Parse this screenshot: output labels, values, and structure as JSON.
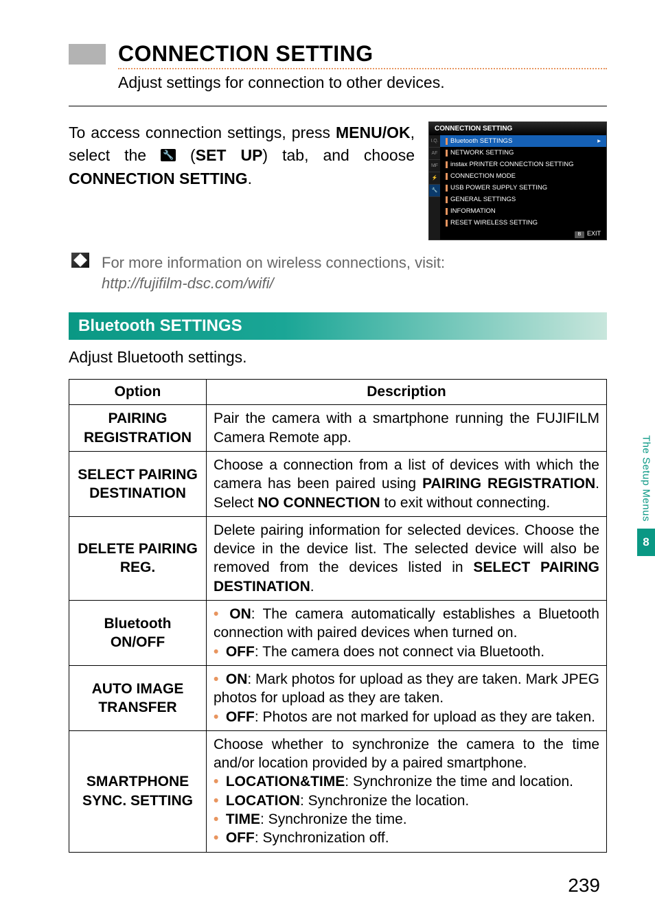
{
  "title": "CONNECTION SETTING",
  "subtitle": "Adjust settings for connection to other devices.",
  "intro_parts": {
    "p1": "To access connection settings, press ",
    "menuok": "MENU/OK",
    "p2": ", select the ",
    "setup": "SET UP",
    "p3": " tab, and choose ",
    "conn": "CONNECTION SETTING",
    "p4": "."
  },
  "menu": {
    "header": "CONNECTION SETTING",
    "items": [
      "Bluetooth SETTINGS",
      "NETWORK SETTING",
      "instax PRINTER CONNECTION SETTING",
      "CONNECTION MODE",
      "USB POWER SUPPLY SETTING",
      "GENERAL SETTINGS",
      "INFORMATION",
      "RESET WIRELESS SETTING"
    ],
    "exit": "EXIT",
    "tabs": [
      "I.Q.",
      "AF MF",
      "",
      "",
      ""
    ]
  },
  "note": {
    "line1": "For more information on wireless connections, visit:",
    "url": "http://fujifilm-dsc.com/wifi/"
  },
  "section": {
    "heading": "Bluetooth SETTINGS",
    "desc": "Adjust Bluetooth settings."
  },
  "table": {
    "head_option": "Option",
    "head_desc": "Description",
    "rows": [
      {
        "option": "PAIRING REGISTRATION",
        "desc_html": "Pair the camera with a smartphone running the FUJIFILM Camera Remote app."
      },
      {
        "option": "SELECT PAIRING DESTINATION",
        "desc_html": "Choose a connection from a list of devices with which the camera has been paired using <b>PAIRING REGISTRATION</b>. Select <b>NO CONNECTION</b> to exit without connecting."
      },
      {
        "option": "DELETE PAIRING REG.",
        "desc_html": "Delete pairing information for selected devices. Choose the device in the device list. The selected device will also be removed from the devices listed in <b>SELECT PAIRING DESTINATION</b>."
      },
      {
        "option": "Bluetooth ON/OFF",
        "desc_html": "<span class='li-dot'>•</span> <b>ON</b>: The camera automatically establishes a Bluetooth connection with paired devices when turned on.<br><span class='li-dot'>•</span> <b>OFF</b>: The camera does not connect via Bluetooth."
      },
      {
        "option": "AUTO IMAGE TRANSFER",
        "desc_html": "<span class='li-dot'>•</span> <b>ON</b>: Mark photos for upload as they are taken. Mark JPEG photos for upload as they are taken.<br><span class='li-dot'>•</span> <b>OFF</b>: Photos are not marked for upload as they are taken."
      },
      {
        "option": "SMARTPHONE SYNC. SETTING",
        "desc_html": "Choose whether to synchronize the camera to the time and/or location provided by a paired smartphone.<br><span class='li-dot'>•</span> <b>LOCATION&TIME</b>: Synchronize the time and location.<br><span class='li-dot'>•</span> <b>LOCATION</b>: Synchronize the location.<br><span class='li-dot'>•</span> <b>TIME</b>: Synchronize the time.<br><span class='li-dot'>•</span> <b>OFF</b>: Synchronization off."
      }
    ]
  },
  "side": {
    "label": "The Setup Menus",
    "badge": "8"
  },
  "pagenum": "239"
}
